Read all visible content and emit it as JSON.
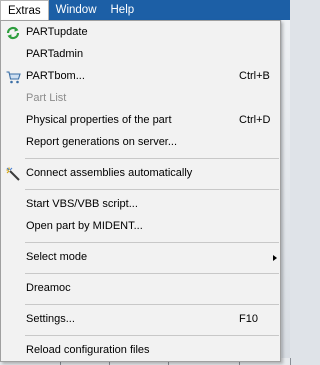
{
  "menubar": {
    "items": [
      {
        "label": "Extras"
      },
      {
        "label": "Window"
      },
      {
        "label": "Help"
      }
    ]
  },
  "menu": {
    "items": [
      {
        "label": "PARTupdate",
        "shortcut": "",
        "icon": "refresh-icon"
      },
      {
        "label": "PARTadmin",
        "shortcut": ""
      },
      {
        "label": "PARTbom...",
        "shortcut": "Ctrl+B",
        "icon": "shopping-cart-icon"
      },
      {
        "label": "Part List",
        "shortcut": "",
        "disabled": true
      },
      {
        "label": "Physical properties of the part",
        "shortcut": "Ctrl+D"
      },
      {
        "label": "Report generations on server...",
        "shortcut": ""
      },
      {
        "label": "Connect assemblies automatically",
        "shortcut": "",
        "icon": "magic-wand-icon"
      },
      {
        "label": "Start VBS/VBB script...",
        "shortcut": ""
      },
      {
        "label": "Open part by MIDENT...",
        "shortcut": ""
      },
      {
        "label": "Select mode",
        "shortcut": "",
        "submenu": true
      },
      {
        "label": "Dreamoc",
        "shortcut": ""
      },
      {
        "label": "Settings...",
        "shortcut": "F10"
      },
      {
        "label": "Reload configuration files",
        "shortcut": ""
      }
    ]
  },
  "colors": {
    "menubar": "#1c5fa6",
    "menu_bg": "#f2f2f2",
    "disabled_text": "#8c8c8c",
    "refresh_icon": "#2e9e3e"
  }
}
